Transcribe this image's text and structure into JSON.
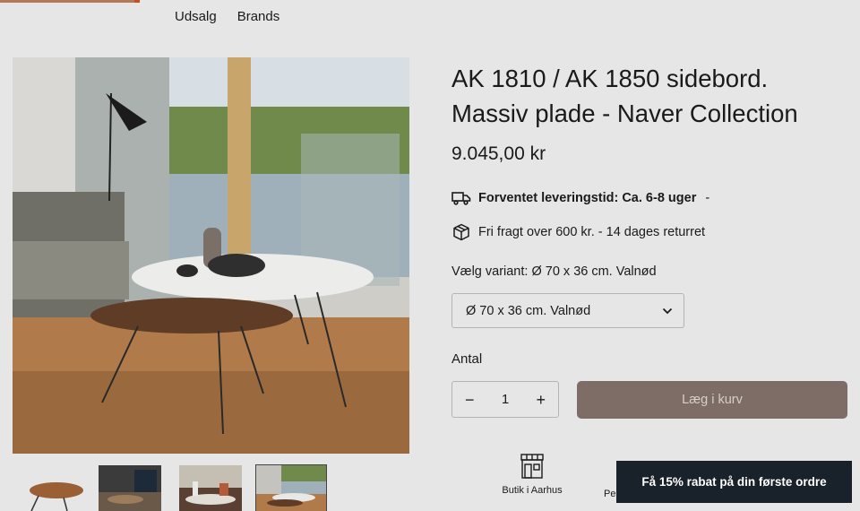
{
  "nav": {
    "items": [
      "Udsalg",
      "Brands"
    ]
  },
  "product": {
    "title": "AK 1810 / AK 1850 sidebord. Massiv plade - Naver Collection",
    "price": "9.045,00 kr"
  },
  "delivery": {
    "text": "Forventet leveringstid: Ca. 6-8 uger",
    "suffix": "-",
    "icon": "truck-icon"
  },
  "freight": {
    "text": "Fri fragt over 600 kr. - 14 dages returret",
    "icon": "package-icon"
  },
  "variant": {
    "label": "Vælg variant: Ø 70 x 36 cm. Valnød",
    "selected": "Ø 70 x 36 cm. Valnød"
  },
  "quantity": {
    "label": "Antal",
    "minus": "−",
    "value": "1",
    "plus": "+"
  },
  "cart": {
    "label": "Læg i kurv"
  },
  "stores": [
    {
      "label": "Butik i Aarhus",
      "icon": "storefront-icon"
    },
    {
      "label": "Pe"
    }
  ],
  "banner": {
    "text": "Få 15% rabat på din første ordre"
  },
  "colors": {
    "cart_button": "#7d6d66",
    "banner": "#19212a",
    "background": "#e6e6e6"
  }
}
